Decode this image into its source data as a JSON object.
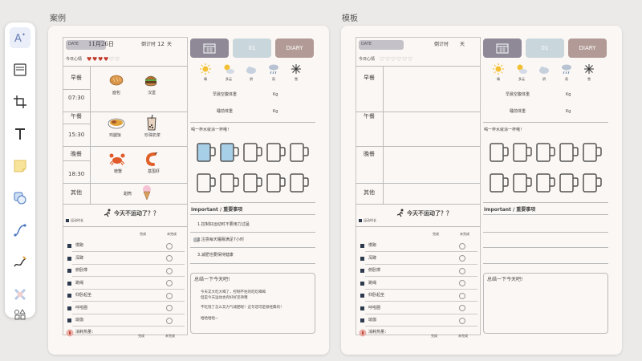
{
  "boards": {
    "left_label": "案例",
    "right_label": "模板"
  },
  "toolbar": {
    "tools": [
      "ai-icon",
      "frame-page-icon",
      "crop-icon",
      "text-tool-icon",
      "sticky-note-icon",
      "shape-icon",
      "connector-icon",
      "pen-icon",
      "cross-eraser-icon",
      "more-shapes-icon"
    ]
  },
  "left": {
    "date_label": "DATE",
    "date_value": "11月26日",
    "countdown_label": "倒计时",
    "countdown_value": "12",
    "countdown_unit": "天",
    "mood_label": "今日心情",
    "tabs": {
      "middle": "01",
      "diary": "DIARY"
    },
    "weather": [
      "晴",
      "多云",
      "阴",
      "雨",
      "雪"
    ],
    "weights": [
      {
        "label": "早晨空腹体重",
        "unit": "Kg"
      },
      {
        "label": "睡前体重",
        "unit": "Kg"
      }
    ],
    "water_prompt": "喝一杯水就涂一杯哦！",
    "meals": [
      {
        "name": "早餐",
        "time": "07:30",
        "foods": [
          "面包",
          "汉堡"
        ]
      },
      {
        "name": "午餐",
        "time": "15:30",
        "foods": [
          "鸡腿饭",
          "珍珠奶茶"
        ]
      },
      {
        "name": "晚餐",
        "time": "18:30",
        "foods": [
          "螃蟹",
          "基围虾"
        ]
      },
      {
        "name": "其他",
        "time": "",
        "foods": [
          "甜筒"
        ]
      }
    ],
    "exercise_title": "今天不运动了？？",
    "exercise_header": {
      "name": "运动时长",
      "done": "完成",
      "todo": "未完成"
    },
    "exercises": [
      "慢跑",
      "深蹲",
      "俯卧撑",
      "跳绳",
      "仰卧起坐",
      "呼啦圈",
      "瑜伽"
    ],
    "burn_label": "消耗热量：",
    "burn_done": "完成",
    "burn_todo": "未完成",
    "important_title": "Important / 重要事项",
    "important_items": [
      "1.控制好运动时不要用力过猛",
      "2.注意每天睡眠满足7小时",
      "3.减肥也要保持健康"
    ],
    "summary_title": "总结一下今天吧!",
    "summary_lines": [
      "今天又大吃大喝了，控制不住的吃吃喝喝",
      "但是今天运动也有好好坚持哦",
      "不吃饱了怎么又力气减肥呢！这句话可是很经典的！",
      "哈哈哈哈~"
    ]
  },
  "right": {
    "date_label": "DATE",
    "countdown_label": "倒计时",
    "countdown_unit": "天",
    "mood_label": "今日心情",
    "tabs": {
      "middle": "01",
      "diary": "DIARY"
    },
    "weather": [
      "晴",
      "多云",
      "阴",
      "雨",
      "雪"
    ],
    "weights": [
      {
        "label": "早晨空腹体重",
        "unit": "Kg"
      },
      {
        "label": "睡前体重",
        "unit": "Kg"
      }
    ],
    "water_prompt": "喝一杯水就涂一杯哦！",
    "meals": [
      "早餐",
      "午餐",
      "晚餐",
      "其他"
    ],
    "exercise_title": "今天不运动了？？",
    "exercise_header": {
      "name": "运动时长",
      "done": "完成",
      "todo": "未完成"
    },
    "exercises": [
      "慢跑",
      "深蹲",
      "俯卧撑",
      "跳绳",
      "仰卧起坐",
      "呼啦圈",
      "瑜伽"
    ],
    "burn_label": "消耗热量：",
    "burn_done": "完成",
    "burn_todo": "未完成",
    "important_title": "Important / 重要事项",
    "summary_title": "总结一下今天吧!"
  },
  "colors": {
    "tile_purple": "#8e8897",
    "tile_blue": "#c9d6dc",
    "tile_brown": "#b29b96",
    "water_fill": "#a8cfe8"
  }
}
